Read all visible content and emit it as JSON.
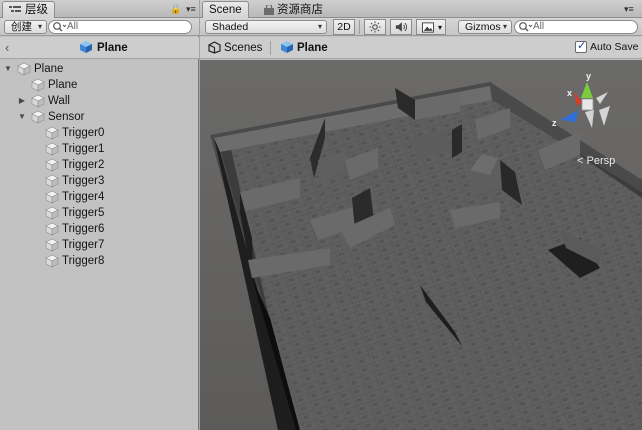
{
  "hierarchy": {
    "tab_label": "层级",
    "create_label": "创建",
    "search_placeholder": "All",
    "title": "Plane",
    "items": [
      {
        "label": "Plane"
      },
      {
        "label": "Plane"
      },
      {
        "label": "Wall"
      },
      {
        "label": "Sensor"
      },
      {
        "label": "Trigger0"
      },
      {
        "label": "Trigger1"
      },
      {
        "label": "Trigger2"
      },
      {
        "label": "Trigger3"
      },
      {
        "label": "Trigger4"
      },
      {
        "label": "Trigger5"
      },
      {
        "label": "Trigger6"
      },
      {
        "label": "Trigger7"
      },
      {
        "label": "Trigger8"
      }
    ]
  },
  "scene": {
    "tab_scene": "Scene",
    "tab_store": "资源商店",
    "shading_mode": "Shaded",
    "mode_2d": "2D",
    "gizmos_label": "Gizmos",
    "search_placeholder": "All",
    "scenes_label": "Scenes",
    "title": "Plane",
    "auto_save_label": "Auto Save",
    "auto_save_checked": true,
    "gizmo": {
      "y": "y",
      "x": "x",
      "z": "z",
      "projection": "Persp"
    }
  },
  "colors": {
    "accent_selected": "#3d6fd4",
    "gizmo_x": "#d93a2a",
    "gizmo_y": "#7ccd3b",
    "gizmo_z": "#2f6fd6",
    "floor": "#555555",
    "wall": "#3b3b3b"
  }
}
